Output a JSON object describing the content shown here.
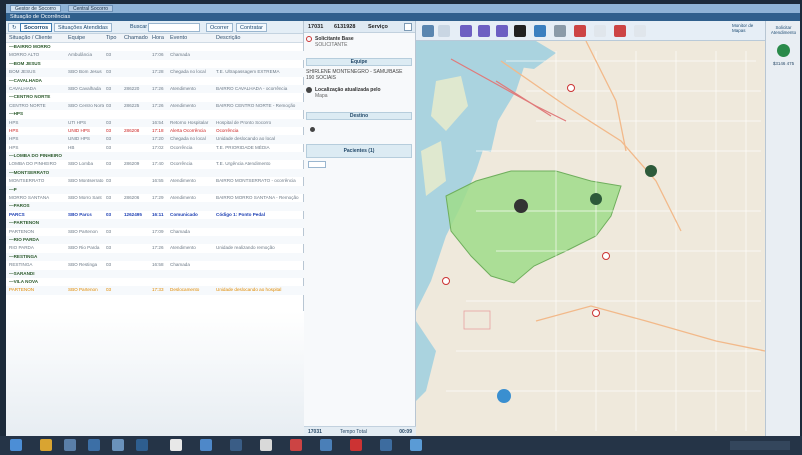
{
  "window": {
    "tabs": [
      "Gestor de Socorro",
      "Central Socorro"
    ],
    "header_title": "Situação de Ocorrências"
  },
  "left_toolbar": {
    "refresh_label": "↻",
    "tab_active": "Socorros",
    "tab_second": "Situações Atendidas",
    "search_label": "Buscar",
    "button_a": "Ocorrer",
    "button_b": "Contratar"
  },
  "columns": [
    "Situação / Cliente",
    "Equipe",
    "Tipo",
    "Chamado",
    "Hora",
    "Evento",
    "Descrição"
  ],
  "rows": [
    {
      "style": "group",
      "cells": [
        "—BAIRRO MORRO",
        "",
        "",
        "",
        "",
        "",
        ""
      ]
    },
    {
      "style": "",
      "cells": [
        "MORRO ALTO",
        "Ambulância",
        "03",
        "",
        "17:06",
        "Chamada",
        ""
      ]
    },
    {
      "style": "group",
      "cells": [
        "—BOM JESUS",
        "",
        "",
        "",
        "",
        "",
        ""
      ]
    },
    {
      "style": "",
      "cells": [
        "BOM JESUS",
        "SBO Bom Jesus",
        "03",
        "",
        "17:28",
        "Chegada no local",
        "T.E. Ultrapassagem EXTREMA"
      ]
    },
    {
      "style": "group",
      "cells": [
        "—CAVALHADA",
        "",
        "",
        "",
        "",
        "",
        ""
      ]
    },
    {
      "style": "",
      "cells": [
        "CAVALHADA",
        "SBO Cavalhada",
        "03",
        "286220",
        "17:26",
        "Atendimento",
        "BAIRRO CAVALHADA - ocorrência"
      ]
    },
    {
      "style": "group",
      "cells": [
        "—CENTRO NORTE",
        "",
        "",
        "",
        "",
        "",
        ""
      ]
    },
    {
      "style": "",
      "cells": [
        "CENTRO NORTE",
        "SBO Centro Norte",
        "03",
        "286225",
        "17:26",
        "Atendimento",
        "BAIRRO CENTRO NORTE - Remoção"
      ]
    },
    {
      "style": "group",
      "cells": [
        "—HPS",
        "",
        "",
        "",
        "",
        "",
        ""
      ]
    },
    {
      "style": "",
      "cells": [
        "HPS",
        "UTI HPS",
        "03",
        "",
        "16:54",
        "Retorno Hospitalar",
        "Hospital de Pronto Socorro"
      ]
    },
    {
      "style": "red",
      "cells": [
        "HPS",
        "UNID HPS",
        "03",
        "286208",
        "17:18",
        "Alerta Ocorrência",
        "Ocorrência"
      ]
    },
    {
      "style": "",
      "cells": [
        "HPS",
        "UNID HPS",
        "03",
        "",
        "17:20",
        "Chegada no local",
        "Unidade deslocando ao local"
      ]
    },
    {
      "style": "",
      "cells": [
        "HPS",
        "HB",
        "03",
        "",
        "17:02",
        "Ocorrência",
        "T.E. PRIORIDADE MÉDIA"
      ]
    },
    {
      "style": "group",
      "cells": [
        "—LOMBA DO PINHEIRO",
        "",
        "",
        "",
        "",
        "",
        ""
      ]
    },
    {
      "style": "",
      "cells": [
        "LOMBA DO PINHEIRO",
        "SBO Lomba",
        "03",
        "286209",
        "17:40",
        "Ocorrência",
        "T.E. Urgência Atendimento"
      ]
    },
    {
      "style": "group",
      "cells": [
        "—MONTSERRATO",
        "",
        "",
        "",
        "",
        "",
        ""
      ]
    },
    {
      "style": "",
      "cells": [
        "MONTSERRATO",
        "SBO Montserrato",
        "03",
        "",
        "16:55",
        "Atendimento",
        "BAIRRO MONTSERRATO - ocorrência"
      ]
    },
    {
      "style": "group",
      "cells": [
        "—P",
        "",
        "",
        "",
        "",
        "",
        ""
      ]
    },
    {
      "style": "",
      "cells": [
        "MORRO SANTANA",
        "SBO Morro Sant",
        "03",
        "286206",
        "17:29",
        "Atendimento",
        "BAIRRO MORRO SANTANA - Remoção"
      ]
    },
    {
      "style": "group",
      "cells": [
        "—PAROS",
        "",
        "",
        "",
        "",
        "",
        ""
      ]
    },
    {
      "style": "blue",
      "cells": [
        "PARCS",
        "SBO Parcs",
        "03",
        "1262495",
        "16:11",
        "Comunicado",
        "Código 1: Ponto Pedal"
      ]
    },
    {
      "style": "group",
      "cells": [
        "—PARTENON",
        "",
        "",
        "",
        "",
        "",
        ""
      ]
    },
    {
      "style": "",
      "cells": [
        "PARTENON",
        "SBO Partenon",
        "03",
        "",
        "17:09",
        "Chamada",
        ""
      ]
    },
    {
      "style": "group",
      "cells": [
        "—RIO PARDA",
        "",
        "",
        "",
        "",
        "",
        ""
      ]
    },
    {
      "style": "",
      "cells": [
        "RIO PARDA",
        "SBO Rio Parda",
        "03",
        "",
        "17:26",
        "Atendimento",
        "Unidade realizando remoção"
      ]
    },
    {
      "style": "group",
      "cells": [
        "—RESTINGA",
        "",
        "",
        "",
        "",
        "",
        ""
      ]
    },
    {
      "style": "",
      "cells": [
        "RESTINGA",
        "SBO Restinga",
        "03",
        "",
        "16:58",
        "Chamada",
        ""
      ]
    },
    {
      "style": "group",
      "cells": [
        "—SARANDI",
        "",
        "",
        "",
        "",
        "",
        ""
      ]
    },
    {
      "style": "group",
      "cells": [
        "—VILA NOVA",
        "",
        "",
        "",
        "",
        "",
        ""
      ]
    },
    {
      "style": "orange",
      "cells": [
        "PARTENON",
        "SBO Partenon",
        "03",
        "",
        "17:33",
        "Deslocamento",
        "Unidade deslocando ao hospital"
      ]
    }
  ],
  "middle": {
    "header_code": "17031",
    "header_time": "6131928",
    "header_status": "Serviço",
    "item1_title": "Solicitante Base",
    "item1_sub": "SOLICITANTE",
    "sect1": "Equipe",
    "item2_text": "SHIRLENE MONTENEGRO - SAMU/BASE 190 SOCIAIS",
    "item3_title": "Localização atualizada pelo",
    "item3_sub": "Mapa",
    "sect2": "Destino",
    "sect3": "Pacientes (1)",
    "footer_left": "17031",
    "footer_mid": "Tempo Total",
    "footer_right": "00:09"
  },
  "map_toolbar": {
    "user_label": "Monitor de Mapas",
    "extra_label": "Solicitar Atendimento"
  },
  "right_panel": {
    "price_label": "$3146 475"
  },
  "colors": {
    "zone_fill": "#9fdc8a",
    "water": "#aad3df",
    "accent": "#2f5f8c"
  }
}
